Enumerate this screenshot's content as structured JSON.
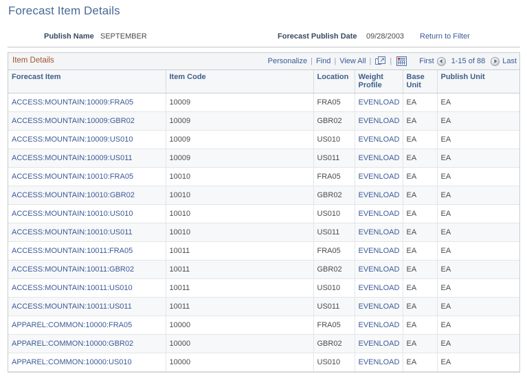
{
  "page": {
    "title": "Forecast Item Details"
  },
  "header": {
    "publish_name_label": "Publish Name",
    "publish_name_value": "SEPTEMBER",
    "publish_date_label": "Forecast Publish Date",
    "publish_date_value": "09/28/2003",
    "return_link": "Return to Filter"
  },
  "grid": {
    "caption": "Item Details",
    "toolbar": {
      "personalize": "Personalize",
      "find": "Find",
      "view_all": "View All",
      "separator": "|",
      "expand_icon": "expand-window-icon",
      "download_icon": "download-grid-icon",
      "first": "First",
      "prev_icon": "previous-page-icon",
      "range": "1-15 of 88",
      "next_icon": "next-page-icon",
      "last": "Last"
    },
    "columns": [
      "Forecast Item",
      "Item Code",
      "Location",
      "Weight Profile",
      "Base Unit",
      "Publish Unit"
    ],
    "rows": [
      {
        "forecast_item": "ACCESS:MOUNTAIN:10009:FRA05",
        "item_code": "10009",
        "location": "FRA05",
        "weight_profile": "EVENLOAD",
        "base_unit": "EA",
        "publish_unit": "EA"
      },
      {
        "forecast_item": "ACCESS:MOUNTAIN:10009:GBR02",
        "item_code": "10009",
        "location": "GBR02",
        "weight_profile": "EVENLOAD",
        "base_unit": "EA",
        "publish_unit": "EA"
      },
      {
        "forecast_item": "ACCESS:MOUNTAIN:10009:US010",
        "item_code": "10009",
        "location": "US010",
        "weight_profile": "EVENLOAD",
        "base_unit": "EA",
        "publish_unit": "EA"
      },
      {
        "forecast_item": "ACCESS:MOUNTAIN:10009:US011",
        "item_code": "10009",
        "location": "US011",
        "weight_profile": "EVENLOAD",
        "base_unit": "EA",
        "publish_unit": "EA"
      },
      {
        "forecast_item": "ACCESS:MOUNTAIN:10010:FRA05",
        "item_code": "10010",
        "location": "FRA05",
        "weight_profile": "EVENLOAD",
        "base_unit": "EA",
        "publish_unit": "EA"
      },
      {
        "forecast_item": "ACCESS:MOUNTAIN:10010:GBR02",
        "item_code": "10010",
        "location": "GBR02",
        "weight_profile": "EVENLOAD",
        "base_unit": "EA",
        "publish_unit": "EA"
      },
      {
        "forecast_item": "ACCESS:MOUNTAIN:10010:US010",
        "item_code": "10010",
        "location": "US010",
        "weight_profile": "EVENLOAD",
        "base_unit": "EA",
        "publish_unit": "EA"
      },
      {
        "forecast_item": "ACCESS:MOUNTAIN:10010:US011",
        "item_code": "10010",
        "location": "US011",
        "weight_profile": "EVENLOAD",
        "base_unit": "EA",
        "publish_unit": "EA"
      },
      {
        "forecast_item": "ACCESS:MOUNTAIN:10011:FRA05",
        "item_code": "10011",
        "location": "FRA05",
        "weight_profile": "EVENLOAD",
        "base_unit": "EA",
        "publish_unit": "EA"
      },
      {
        "forecast_item": "ACCESS:MOUNTAIN:10011:GBR02",
        "item_code": "10011",
        "location": "GBR02",
        "weight_profile": "EVENLOAD",
        "base_unit": "EA",
        "publish_unit": "EA"
      },
      {
        "forecast_item": "ACCESS:MOUNTAIN:10011:US010",
        "item_code": "10011",
        "location": "US010",
        "weight_profile": "EVENLOAD",
        "base_unit": "EA",
        "publish_unit": "EA"
      },
      {
        "forecast_item": "ACCESS:MOUNTAIN:10011:US011",
        "item_code": "10011",
        "location": "US011",
        "weight_profile": "EVENLOAD",
        "base_unit": "EA",
        "publish_unit": "EA"
      },
      {
        "forecast_item": "APPAREL:COMMON:10000:FRA05",
        "item_code": "10000",
        "location": "FRA05",
        "weight_profile": "EVENLOAD",
        "base_unit": "EA",
        "publish_unit": "EA"
      },
      {
        "forecast_item": "APPAREL:COMMON:10000:GBR02",
        "item_code": "10000",
        "location": "GBR02",
        "weight_profile": "EVENLOAD",
        "base_unit": "EA",
        "publish_unit": "EA"
      },
      {
        "forecast_item": "APPAREL:COMMON:10000:US010",
        "item_code": "10000",
        "location": "US010",
        "weight_profile": "EVENLOAD",
        "base_unit": "EA",
        "publish_unit": "EA"
      }
    ]
  },
  "colors": {
    "title": "#4a6a94",
    "link": "#3b5998",
    "caption": "#a3522a",
    "header_text": "#3e5f8a",
    "grid_border": "#c8cdd3",
    "row_alt": "#f7f8f9"
  }
}
